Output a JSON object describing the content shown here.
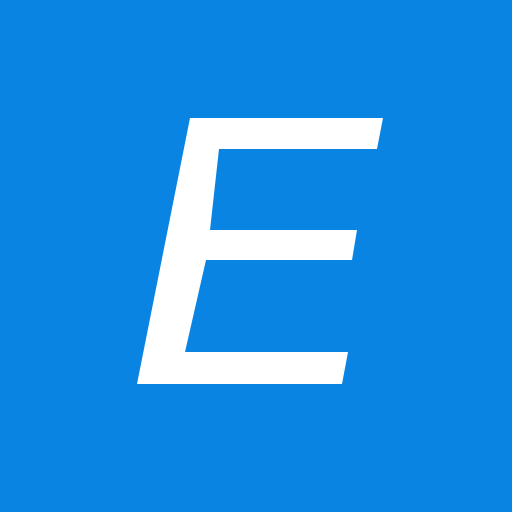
{
  "logo": {
    "letter": "E",
    "icon": "letter-e-logo-icon"
  },
  "colors": {
    "background": "#0984E3",
    "foreground": "#FFFFFF"
  }
}
